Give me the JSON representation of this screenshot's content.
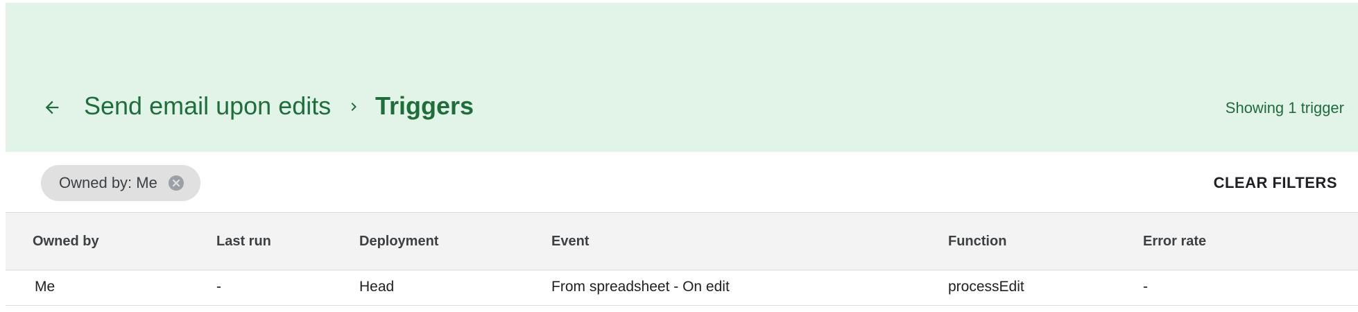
{
  "header": {
    "back_icon": "arrow-back-icon",
    "project_name": "Send email upon edits",
    "separator_icon": "chevron-right-icon",
    "current_page": "Triggers",
    "showing_text": "Showing 1 trigger",
    "background_color": "#e2f3e8",
    "accent_color": "#1e6e3c"
  },
  "filters": {
    "chip_label": "Owned by: Me",
    "chip_close_icon": "close-circle-icon",
    "clear_label": "CLEAR FILTERS"
  },
  "table": {
    "columns": [
      "Owned by",
      "Last run",
      "Deployment",
      "Event",
      "Function",
      "Error rate"
    ],
    "rows": [
      [
        "Me",
        "-",
        "Head",
        "From spreadsheet - On edit",
        "processEdit",
        "-"
      ]
    ]
  }
}
